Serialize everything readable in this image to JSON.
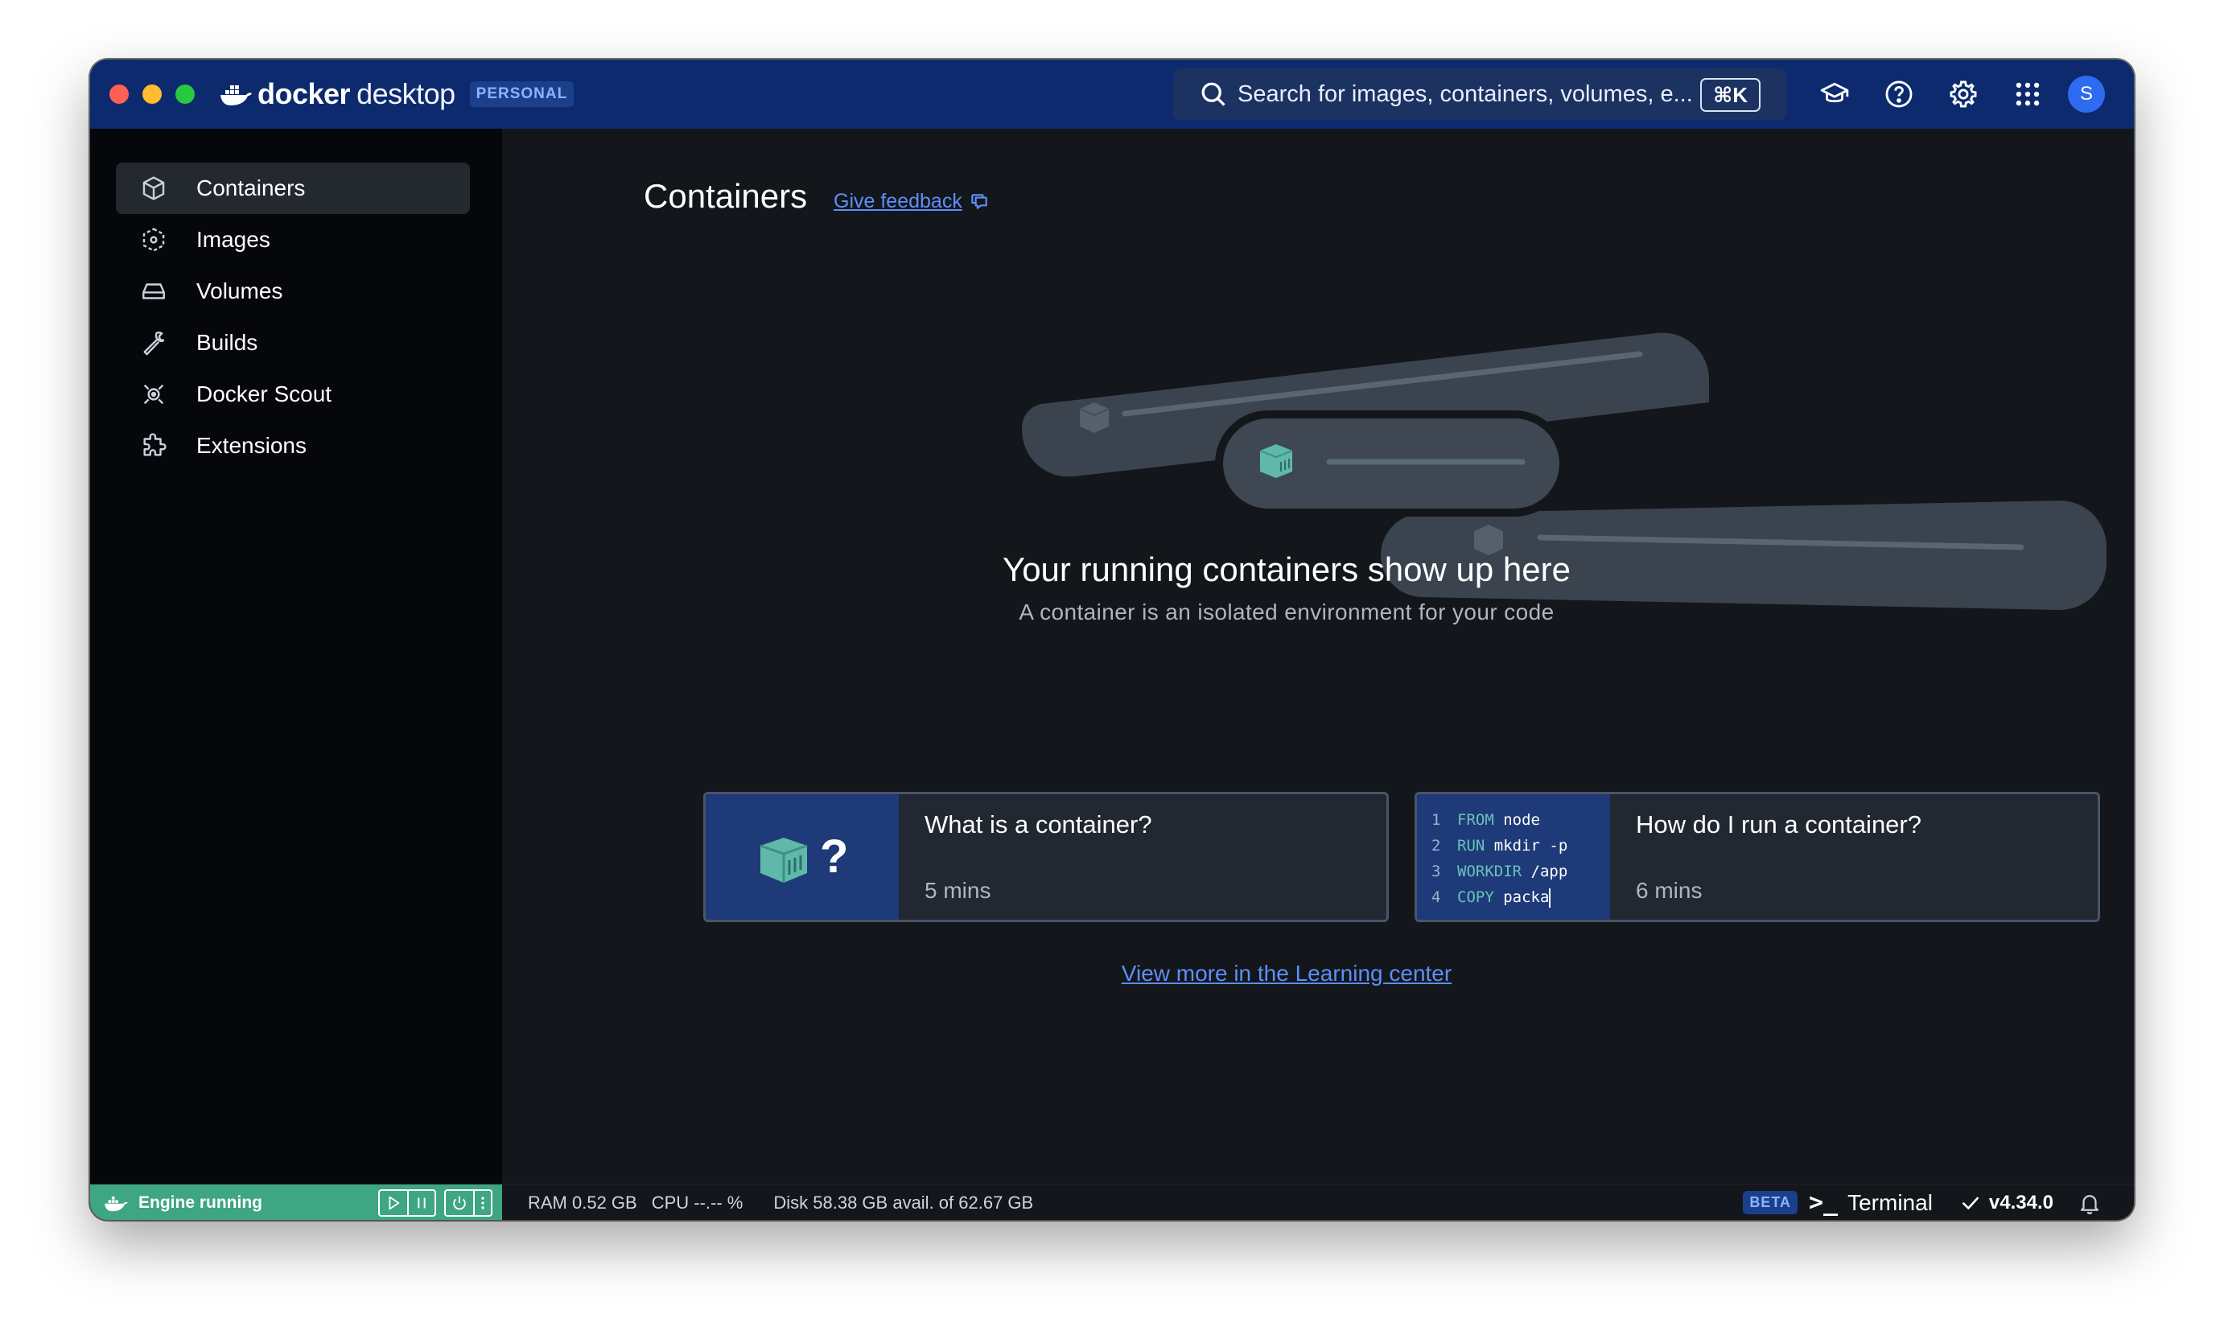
{
  "brand": {
    "name_bold": "docker",
    "name_light": "desktop",
    "plan_badge": "PERSONAL"
  },
  "search": {
    "placeholder": "Search for images, containers, volumes, e...",
    "shortcut": "⌘K"
  },
  "header_icons": [
    "learning-center-icon",
    "help-icon",
    "settings-icon",
    "apps-grid-icon"
  ],
  "user": {
    "avatar_initial": "S"
  },
  "sidebar": {
    "items": [
      {
        "label": "Containers",
        "icon": "container-icon",
        "active": true
      },
      {
        "label": "Images",
        "icon": "images-icon",
        "active": false
      },
      {
        "label": "Volumes",
        "icon": "volumes-icon",
        "active": false
      },
      {
        "label": "Builds",
        "icon": "builds-icon",
        "active": false
      },
      {
        "label": "Docker Scout",
        "icon": "scout-icon",
        "active": false
      },
      {
        "label": "Extensions",
        "icon": "extensions-icon",
        "active": false
      }
    ]
  },
  "main": {
    "title": "Containers",
    "feedback_link": "Give feedback",
    "empty_title": "Your running containers show up here",
    "empty_subtitle": "A container is an isolated environment for your code",
    "cards": [
      {
        "title": "What is a container?",
        "duration": "5 mins",
        "thumb_symbol": "?"
      },
      {
        "title": "How do I run a container?",
        "duration": "6 mins",
        "code": [
          {
            "n": "1",
            "kw": "FROM",
            "rest": "node"
          },
          {
            "n": "2",
            "kw": "RUN",
            "rest": "mkdir -p"
          },
          {
            "n": "3",
            "kw": "WORKDIR",
            "rest": "/app"
          },
          {
            "n": "4",
            "kw": "COPY",
            "rest": "packa"
          }
        ]
      }
    ],
    "learning_link": "View more in the Learning center"
  },
  "footer": {
    "engine_status": "Engine running",
    "ram": "RAM 0.52 GB",
    "cpu": "CPU --.-- %",
    "disk": "Disk 58.38 GB avail. of 62.67 GB",
    "beta_badge": "BETA",
    "terminal_prompt": ">_",
    "terminal_label": "Terminal",
    "version": "v4.34.0"
  },
  "colors": {
    "titlebar": "#0d2a6e",
    "sidebar": "#05070a",
    "main_bg": "#13161b",
    "engine_running": "#3ea682",
    "link": "#5d8ff7",
    "accent_teal": "#69c3b9"
  }
}
